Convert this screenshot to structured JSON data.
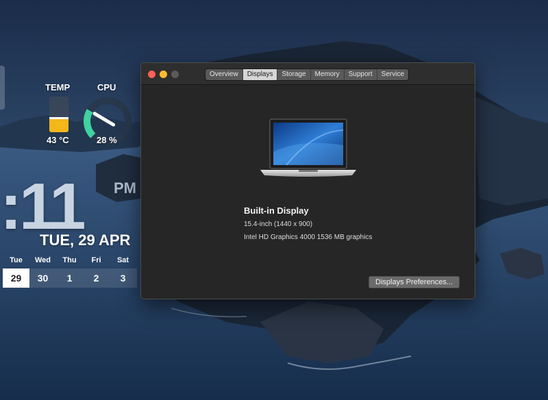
{
  "widgets": {
    "temp": {
      "label": "TEMP",
      "value": "43 °C",
      "fill_fraction": 0.42,
      "fill_color": "#f3b71a"
    },
    "cpu": {
      "label": "CPU",
      "value": "28 %",
      "fraction": 0.28,
      "arc_color": "#3ed3a0"
    }
  },
  "clock": {
    "digits": ":11",
    "ampm": "PM",
    "date": "TUE, 29 APR",
    "weekdays": [
      "Tue",
      "Wed",
      "Thu",
      "Fri",
      "Sat"
    ],
    "dates": [
      "29",
      "30",
      "1",
      "2",
      "3"
    ],
    "today_index": 0
  },
  "window": {
    "tabs": [
      "Overview",
      "Displays",
      "Storage",
      "Memory",
      "Support",
      "Service"
    ],
    "active_tab": "Displays",
    "display": {
      "title": "Built-in Display",
      "size": "15.4-inch (1440 x 900)",
      "graphics": "Intel HD Graphics 4000 1536 MB graphics"
    },
    "preferences_button": "Displays Preferences..."
  },
  "colors": {
    "accent_close": "#ff5f57",
    "accent_minimize": "#febc2e"
  }
}
